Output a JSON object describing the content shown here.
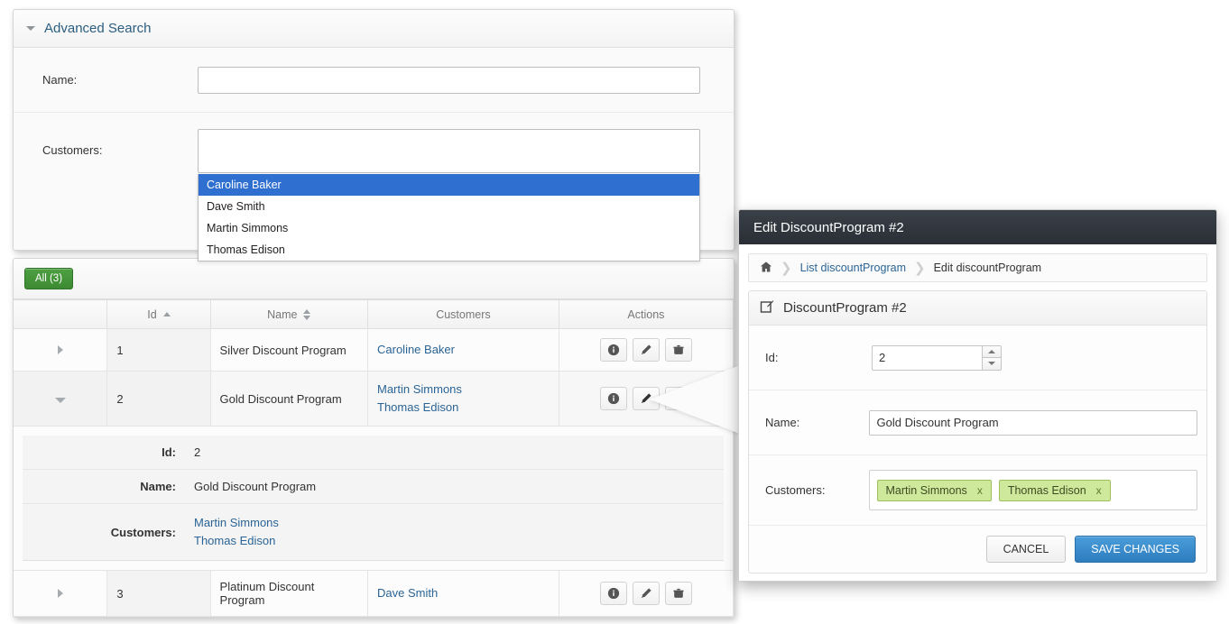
{
  "search_panel": {
    "title": "Advanced Search",
    "collapse_icon": "caret-down-icon",
    "fields": {
      "name_label": "Name:",
      "name_value": "",
      "name_placeholder": "",
      "customers_label": "Customers:",
      "customers_value": "",
      "customers_placeholder": ""
    },
    "dropdown": {
      "options": [
        "Caroline Baker",
        "Dave Smith",
        "Martin Simmons",
        "Thomas Edison"
      ],
      "selected_index": 0,
      "highlight_color": "#2f6fd0"
    }
  },
  "grid": {
    "filter_button": "All (3)",
    "filter_button_color": "#3d8a33",
    "columns": [
      "",
      "Id",
      "Name",
      "Customers",
      "Actions"
    ],
    "sort": {
      "id": "asc",
      "name": "none"
    },
    "rows": [
      {
        "expanded": false,
        "id": "1",
        "name": "Silver Discount Program",
        "customers": [
          "Caroline Baker"
        ],
        "actions": [
          "info-icon",
          "pencil-icon",
          "trash-icon"
        ]
      },
      {
        "expanded": true,
        "id": "2",
        "name": "Gold Discount Program",
        "customers": [
          "Martin Simmons",
          "Thomas Edison"
        ],
        "actions": [
          "info-icon",
          "pencil-icon",
          "trash-icon"
        ]
      },
      {
        "expanded": false,
        "id": "3",
        "name": "Platinum Discount Program",
        "customers": [
          "Dave Smith"
        ],
        "actions": [
          "info-icon",
          "pencil-icon",
          "trash-icon"
        ]
      }
    ],
    "detail": {
      "id_label": "Id:",
      "id_value": "2",
      "name_label": "Name:",
      "name_value": "Gold Discount Program",
      "customers_label": "Customers:",
      "customers": [
        "Martin Simmons",
        "Thomas Edison"
      ]
    }
  },
  "modal": {
    "title": "Edit DiscountProgram #2",
    "title_bar_color": "#2a2f36",
    "breadcrumb": {
      "home_icon": "home-icon",
      "items": [
        {
          "label": "List discountProgram",
          "current": false
        },
        {
          "label": "Edit discountProgram",
          "current": true
        }
      ]
    },
    "panel": {
      "icon": "edit-square-icon",
      "heading": "DiscountProgram #2",
      "id_label": "Id:",
      "id_value": "2",
      "name_label": "Name:",
      "name_value": "Gold Discount Program",
      "customers_label": "Customers:",
      "chips": [
        {
          "label": "Martin Simmons",
          "remove": "x"
        },
        {
          "label": "Thomas Edison",
          "remove": "x"
        }
      ],
      "chip_color": "#cfe99c"
    },
    "footer": {
      "cancel_label": "CANCEL",
      "save_label": "SAVE CHANGES",
      "save_color": "#2e7dbe"
    }
  }
}
